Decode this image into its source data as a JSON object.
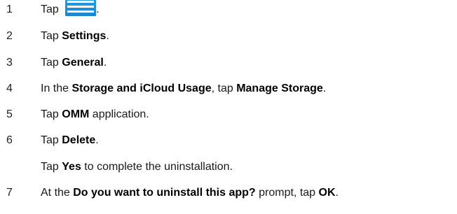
{
  "steps": [
    {
      "number": "1",
      "parts": [
        {
          "t": "Tap "
        },
        {
          "icon": "hamburger-menu-icon"
        },
        {
          "t": "."
        }
      ]
    },
    {
      "number": "2",
      "parts": [
        {
          "t": "Tap "
        },
        {
          "b": "Settings"
        },
        {
          "t": "."
        }
      ]
    },
    {
      "number": "3",
      "parts": [
        {
          "t": "Tap "
        },
        {
          "b": "General"
        },
        {
          "t": "."
        }
      ]
    },
    {
      "number": "4",
      "parts": [
        {
          "t": "In the "
        },
        {
          "b": "Storage and iCloud Usage"
        },
        {
          "t": ", tap "
        },
        {
          "b": "Manage Storage"
        },
        {
          "t": "."
        }
      ]
    },
    {
      "number": "5",
      "parts": [
        {
          "t": "Tap "
        },
        {
          "b": "OMM"
        },
        {
          "t": " application."
        }
      ]
    },
    {
      "number": "6",
      "parts": [
        {
          "t": "Tap "
        },
        {
          "b": "Delete"
        },
        {
          "t": "."
        }
      ]
    },
    {
      "number": "",
      "parts": [
        {
          "t": "Tap "
        },
        {
          "b": "Yes"
        },
        {
          "t": " to complete the uninstallation."
        }
      ]
    },
    {
      "number": "7",
      "parts": [
        {
          "t": "At the "
        },
        {
          "b": "Do you want to uninstall this app?"
        },
        {
          "t": " prompt, tap "
        },
        {
          "b": "OK"
        },
        {
          "t": "."
        }
      ]
    }
  ],
  "colors": {
    "icon_blue": "#1a86cf",
    "text": "#1a1a1a"
  }
}
